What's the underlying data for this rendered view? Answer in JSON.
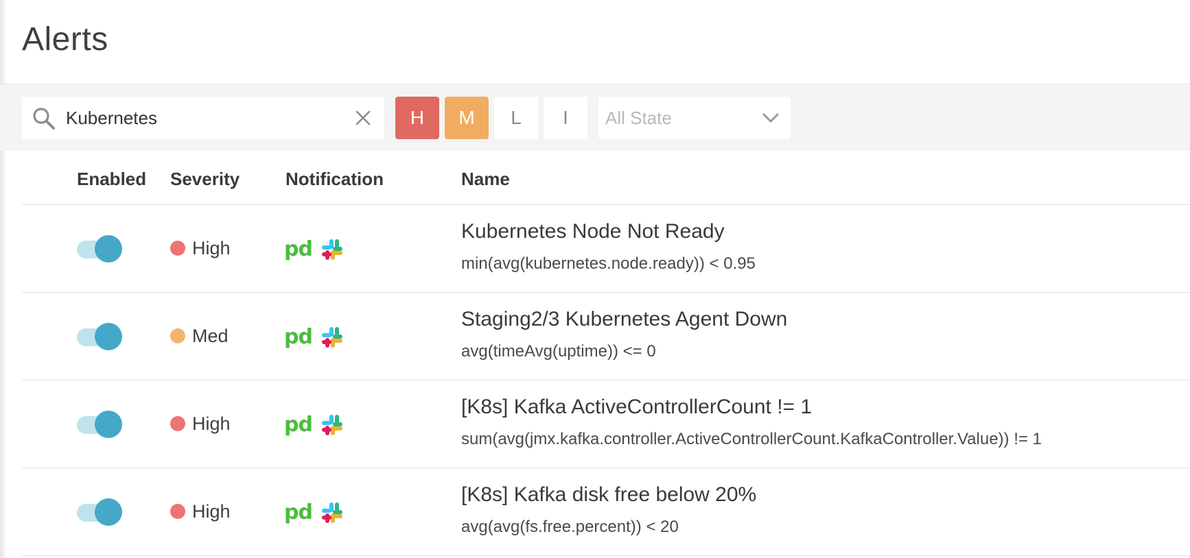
{
  "page": {
    "title": "Alerts"
  },
  "filters": {
    "search_value": "Kubernetes",
    "severity_buttons": [
      "H",
      "M",
      "L",
      "I"
    ],
    "state_select": "All State"
  },
  "table": {
    "headers": {
      "enabled": "Enabled",
      "severity": "Severity",
      "notification": "Notification",
      "name": "Name"
    },
    "rows": [
      {
        "enabled": true,
        "severity": "High",
        "severity_color": "#ee7373",
        "notifications": [
          "pd",
          "slack"
        ],
        "name": "Kubernetes Node Not Ready",
        "query": "min(avg(kubernetes.node.ready)) < 0.95"
      },
      {
        "enabled": true,
        "severity": "Med",
        "severity_color": "#f2b56b",
        "notifications": [
          "pd",
          "slack"
        ],
        "name": "Staging2/3 Kubernetes Agent Down",
        "query": "avg(timeAvg(uptime)) <= 0"
      },
      {
        "enabled": true,
        "severity": "High",
        "severity_color": "#ee7373",
        "notifications": [
          "pd",
          "slack"
        ],
        "name": "[K8s] Kafka ActiveControllerCount != 1",
        "query": "sum(avg(jmx.kafka.controller.ActiveControllerCount.KafkaController.Value)) != 1"
      },
      {
        "enabled": true,
        "severity": "High",
        "severity_color": "#ee7373",
        "notifications": [
          "pd",
          "slack"
        ],
        "name": "[K8s] Kafka disk free below 20%",
        "query": "avg(avg(fs.free.percent)) < 20"
      }
    ]
  },
  "colors": {
    "severity_high_button": "#e06a62",
    "severity_med_button": "#f0ad60",
    "toggle_on": "#45a8c8",
    "pagerduty_green": "#4dbb3f"
  }
}
